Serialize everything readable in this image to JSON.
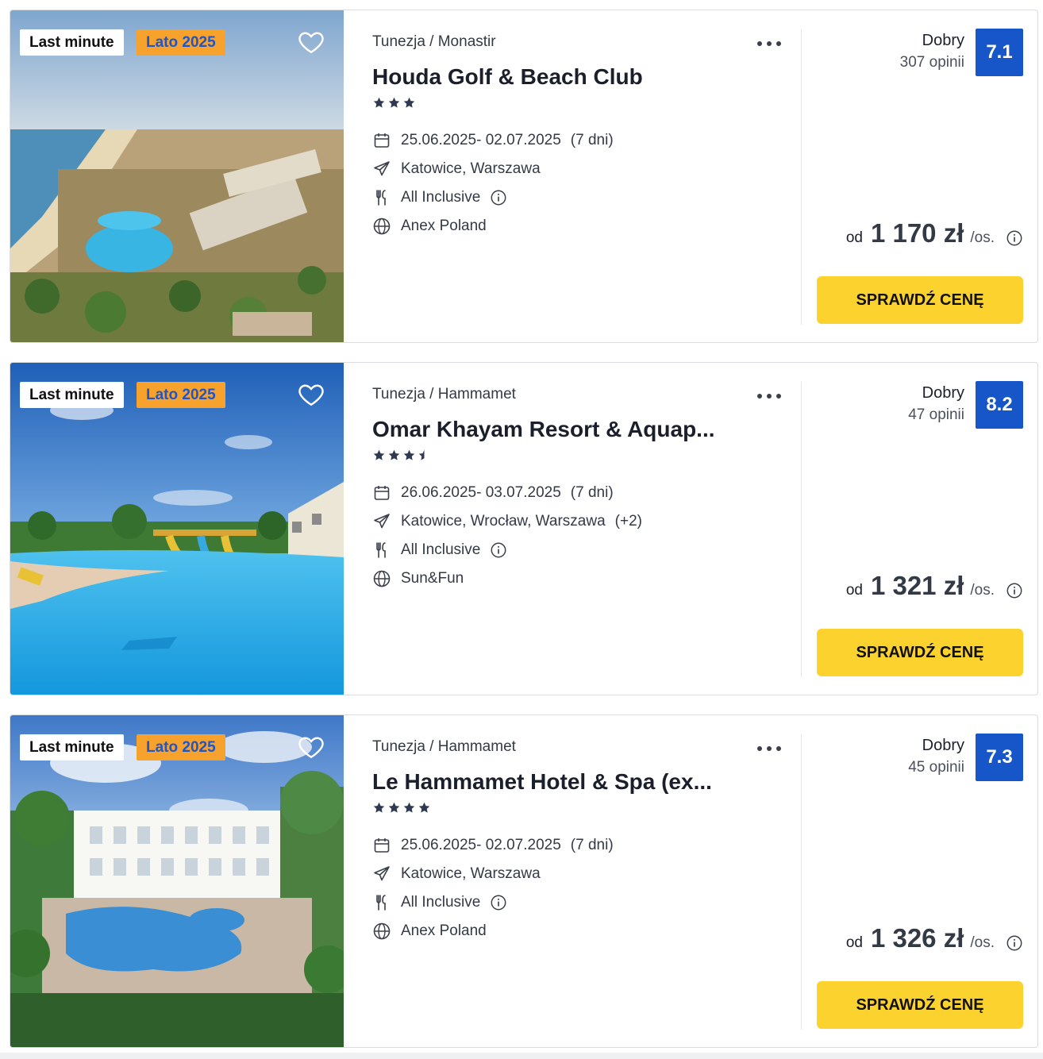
{
  "offers": [
    {
      "badges": {
        "last_minute": "Last minute",
        "season": "Lato 2025"
      },
      "location": {
        "country": "Tunezja",
        "separator": "/",
        "city": "Monastir"
      },
      "hotel_name": "Houda Golf & Beach Club",
      "stars": 3,
      "dates": "25.06.2025- 02.07.2025",
      "duration": "(7 dni)",
      "departures": "Katowice, Warszawa",
      "departures_extra": "",
      "board": "All Inclusive",
      "operator": "Anex Poland",
      "rating": {
        "label": "Dobry",
        "count": "307 opinii",
        "score": "7.1"
      },
      "price": {
        "prefix": "od",
        "amount": "1 170 zł",
        "suffix": "/os."
      },
      "cta": "SPRAWDŹ CENĘ"
    },
    {
      "badges": {
        "last_minute": "Last minute",
        "season": "Lato 2025"
      },
      "location": {
        "country": "Tunezja",
        "separator": "/",
        "city": "Hammamet"
      },
      "hotel_name": "Omar Khayam Resort & Aquap...",
      "stars": 3.5,
      "dates": "26.06.2025- 03.07.2025",
      "duration": "(7 dni)",
      "departures": "Katowice, Wrocław, Warszawa",
      "departures_extra": "(+2)",
      "board": "All Inclusive",
      "operator": "Sun&Fun",
      "rating": {
        "label": "Dobry",
        "count": "47 opinii",
        "score": "8.2"
      },
      "price": {
        "prefix": "od",
        "amount": "1 321 zł",
        "suffix": "/os."
      },
      "cta": "SPRAWDŹ CENĘ"
    },
    {
      "badges": {
        "last_minute": "Last minute",
        "season": "Lato 2025"
      },
      "location": {
        "country": "Tunezja",
        "separator": "/",
        "city": "Hammamet"
      },
      "hotel_name": "Le Hammamet Hotel & Spa (ex...",
      "stars": 4,
      "dates": "25.06.2025- 02.07.2025",
      "duration": "(7 dni)",
      "departures": "Katowice, Warszawa",
      "departures_extra": "",
      "board": "All Inclusive",
      "operator": "Anex Poland",
      "rating": {
        "label": "Dobry",
        "count": "45 opinii",
        "score": "7.3"
      },
      "price": {
        "prefix": "od",
        "amount": "1 326 zł",
        "suffix": "/os."
      },
      "cta": "SPRAWDŹ CENĘ"
    }
  ],
  "colors": {
    "accent_yellow": "#fcd22e",
    "score_blue": "#1656c8",
    "season_badge_bg": "#f6a22c",
    "season_badge_text": "#1f55c9",
    "star_color": "#2f3a52"
  },
  "icons": {
    "favorite": "heart-outline-icon",
    "more": "more-dots-icon",
    "dates": "calendar-icon",
    "departures": "airplane-icon",
    "board": "cutlery-icon",
    "operator": "globe-icon",
    "info": "info-circle-icon",
    "star": "star-icon"
  }
}
